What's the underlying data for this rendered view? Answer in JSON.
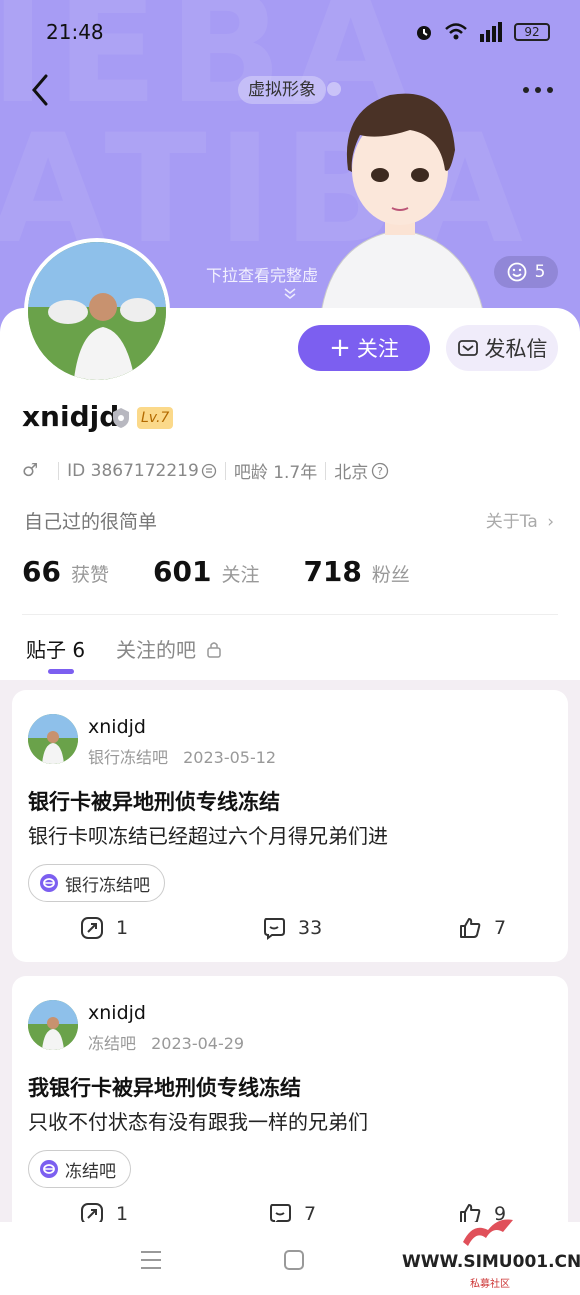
{
  "status": {
    "time": "21:48",
    "battery": "92"
  },
  "header": {
    "avatar_tag": "虚拟形象",
    "pull_hint": "下拉查看完整虚",
    "like_count": "5",
    "bg_letters": "IEBA\nATIBA"
  },
  "profile": {
    "username": "xnidjd",
    "level": "Lv.7",
    "gender_icon": "♂",
    "id_text": "ID 3867172219",
    "age": "吧龄 1.7年",
    "location": "北京",
    "bio": "自己过的很简单",
    "about": "关于Ta",
    "follow_label": "关注",
    "message_label": "发私信"
  },
  "stats": [
    {
      "num": "66",
      "label": "获赞"
    },
    {
      "num": "601",
      "label": "关注"
    },
    {
      "num": "718",
      "label": "粉丝"
    }
  ],
  "tabs": {
    "posts": "贴子 6",
    "followed": "关注的吧"
  },
  "posts": [
    {
      "user": "xnidjd",
      "forum_meta": "银行冻结吧",
      "date": "2023-05-12",
      "title": "银行卡被异地刑侦专线冻结",
      "body": "银行卡呗冻结已经超过六个月得兄弟们进",
      "forum": "银行冻结吧",
      "shares": "1",
      "comments": "33",
      "likes": "7"
    },
    {
      "user": "xnidjd",
      "forum_meta": "冻结吧",
      "date": "2023-04-29",
      "title": "我银行卡被异地刑侦专线冻结",
      "body": "只收不付状态有没有跟我一样的兄弟们",
      "forum": "冻结吧",
      "shares": "1",
      "comments": "7",
      "likes": "9"
    }
  ],
  "watermark": {
    "text": "WWW.SIMU001.CN",
    "sub": "私募社区"
  },
  "colors": {
    "header_bg": "#a79cf4",
    "accent": "#7c5ff0",
    "level_bg": "#fbd98a"
  }
}
